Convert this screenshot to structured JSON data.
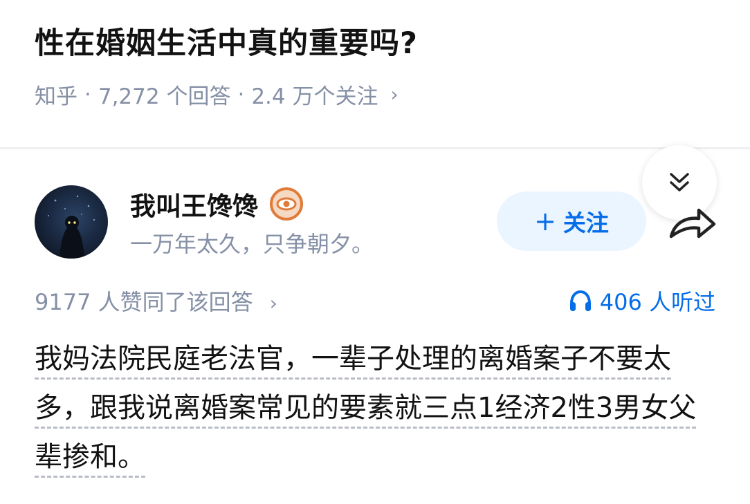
{
  "question": {
    "title": "性在婚姻生活中真的重要吗?",
    "source": "知乎",
    "answers": "7,272 个回答",
    "followers": "2.4 万个关注",
    "chevron": "›"
  },
  "author": {
    "name": "我叫王馋馋",
    "bio": "一万年太久，只争朝夕。",
    "badge_icon": "eye-badge-icon",
    "avatar": "dark-night-avatar"
  },
  "actions": {
    "follow_plus": "+",
    "follow_label": "关注",
    "collapse_icon": "double-chevron-down-icon",
    "share_icon": "share-arrow-icon"
  },
  "stats": {
    "votes": "9177 人赞同了该回答",
    "chevron": "›",
    "listens": "406 人听过",
    "listen_icon": "headphones-icon"
  },
  "answer": {
    "text": "我妈法院民庭老法官，一辈子处理的离婚案子不要太多，跟我说离婚案常见的要素就三点1经济2性3男女父辈掺和。"
  },
  "colors": {
    "accent": "#056de8",
    "accent_bg": "#ebf5ff",
    "muted": "#8590a6",
    "badge": "#e07b39"
  }
}
